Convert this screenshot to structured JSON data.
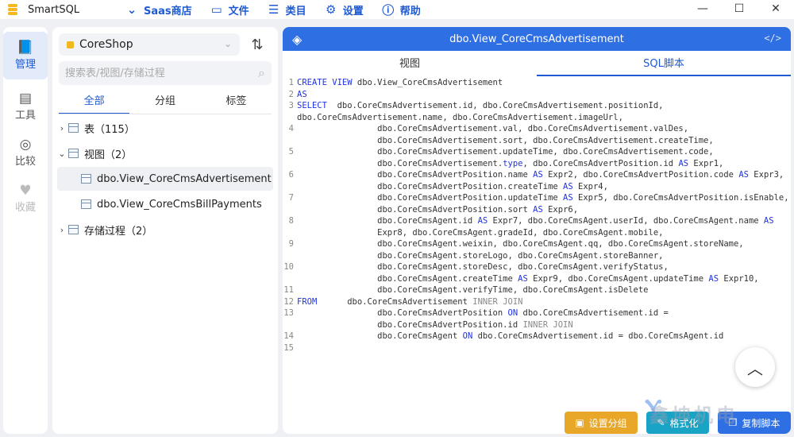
{
  "app": {
    "title": "SmartSQL"
  },
  "menu": [
    {
      "icon": "chevron-down-icon",
      "glyph": "⌄",
      "label": "Saas商店"
    },
    {
      "icon": "folder-icon",
      "glyph": "▭",
      "label": "文件"
    },
    {
      "icon": "list-icon",
      "glyph": "☰",
      "label": "类目"
    },
    {
      "icon": "gear-icon",
      "glyph": "⚙",
      "label": "设置"
    },
    {
      "icon": "info-icon",
      "glyph": "ⓘ",
      "label": "帮助"
    }
  ],
  "rail": {
    "manage": "管理",
    "tools": "工具",
    "compare": "比较",
    "favorites": "收藏"
  },
  "tree": {
    "database": "CoreShop",
    "search_placeholder": "搜索表/视图/存储过程",
    "tabs": [
      "全部",
      "分组",
      "标签"
    ],
    "tables": "表（115）",
    "views": "视图（2）",
    "view_items": [
      "dbo.View_CoreCmsAdvertisement",
      "dbo.View_CoreCmsBillPayments"
    ],
    "procs": "存储过程（2）"
  },
  "editor": {
    "title": "dbo.View_CoreCmsAdvertisement",
    "tab_view": "视图",
    "tab_sql": "SQL脚本"
  },
  "code_lines": [
    {
      "n": "1",
      "t": "<span class='kw'>CREATE VIEW</span> dbo.View_CoreCmsAdvertisement"
    },
    {
      "n": "2",
      "t": "<span class='kw'>AS</span>"
    },
    {
      "n": "3",
      "t": "<span class='kw'>SELECT</span>  dbo.CoreCmsAdvertisement.id, dbo.CoreCmsAdvertisement.positionId,"
    },
    {
      "n": "",
      "t": "dbo.CoreCmsAdvertisement.name, dbo.CoreCmsAdvertisement.imageUrl,"
    },
    {
      "n": "4",
      "t": "                dbo.CoreCmsAdvertisement.val, dbo.CoreCmsAdvertisement.valDes,"
    },
    {
      "n": "",
      "t": "                dbo.CoreCmsAdvertisement.sort, dbo.CoreCmsAdvertisement.createTime,"
    },
    {
      "n": "5",
      "t": "                dbo.CoreCmsAdvertisement.updateTime, dbo.CoreCmsAdvertisement.code,"
    },
    {
      "n": "",
      "t": "                dbo.CoreCmsAdvertisement.<span class='kw'>type</span>, dbo.CoreCmsAdvertPosition.id <span class='kw'>AS</span> Expr1,"
    },
    {
      "n": "6",
      "t": "                dbo.CoreCmsAdvertPosition.name <span class='kw'>AS</span> Expr2, dbo.CoreCmsAdvertPosition.code <span class='kw'>AS</span> Expr3,"
    },
    {
      "n": "",
      "t": "                dbo.CoreCmsAdvertPosition.createTime <span class='kw'>AS</span> Expr4,"
    },
    {
      "n": "7",
      "t": "                dbo.CoreCmsAdvertPosition.updateTime <span class='kw'>AS</span> Expr5, dbo.CoreCmsAdvertPosition.isEnable,"
    },
    {
      "n": "",
      "t": "                dbo.CoreCmsAdvertPosition.sort <span class='kw'>AS</span> Expr6,"
    },
    {
      "n": "8",
      "t": "                dbo.CoreCmsAgent.id <span class='kw'>AS</span> Expr7, dbo.CoreCmsAgent.userId, dbo.CoreCmsAgent.name <span class='kw'>AS</span>"
    },
    {
      "n": "",
      "t": "                Expr8, dbo.CoreCmsAgent.gradeId, dbo.CoreCmsAgent.mobile,"
    },
    {
      "n": "9",
      "t": "                dbo.CoreCmsAgent.weixin, dbo.CoreCmsAgent.qq, dbo.CoreCmsAgent.storeName,"
    },
    {
      "n": "",
      "t": "                dbo.CoreCmsAgent.storeLogo, dbo.CoreCmsAgent.storeBanner,"
    },
    {
      "n": "10",
      "t": "                dbo.CoreCmsAgent.storeDesc, dbo.CoreCmsAgent.verifyStatus,"
    },
    {
      "n": "",
      "t": "                dbo.CoreCmsAgent.createTime <span class='kw'>AS</span> Expr9, dbo.CoreCmsAgent.updateTime <span class='kw'>AS</span> Expr10,"
    },
    {
      "n": "11",
      "t": "                dbo.CoreCmsAgent.verifyTime, dbo.CoreCmsAgent.isDelete"
    },
    {
      "n": "12",
      "t": "<span class='kw'>FROM</span>      dbo.CoreCmsAdvertisement <span class='kw2'>INNER JOIN</span>"
    },
    {
      "n": "13",
      "t": "                dbo.CoreCmsAdvertPosition <span class='kw'>ON</span> dbo.CoreCmsAdvertisement.id ="
    },
    {
      "n": "",
      "t": "                dbo.CoreCmsAdvertPosition.id <span class='kw2'>INNER JOIN</span>"
    },
    {
      "n": "14",
      "t": "                dbo.CoreCmsAgent <span class='kw'>ON</span> dbo.CoreCmsAdvertisement.id = dbo.CoreCmsAgent.id"
    },
    {
      "n": "15",
      "t": ""
    }
  ],
  "buttons": {
    "group": "设置分组",
    "format": "格式化",
    "copy": "复制脚本"
  },
  "watermark": "鑫坤机电"
}
